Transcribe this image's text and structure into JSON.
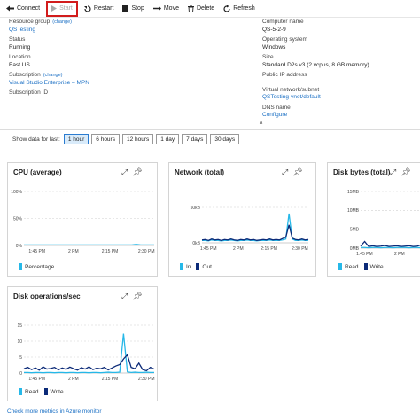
{
  "toolbar": {
    "connect": "Connect",
    "start": "Start",
    "restart": "Restart",
    "stop": "Stop",
    "move": "Move",
    "delete": "Delete",
    "refresh": "Refresh"
  },
  "essentials": {
    "resource_group_label": "Resource group",
    "change_label": "(change)",
    "resource_group_value": "QSTesting",
    "status_label": "Status",
    "status_value": "Running",
    "location_label": "Location",
    "location_value": "East US",
    "subscription_label": "Subscription",
    "subscription_value": "Visual Studio Enterprise – MPN",
    "subscription_id_label": "Subscription ID",
    "computer_name_label": "Computer name",
    "computer_name_value": "QS-5-2-9",
    "os_label": "Operating system",
    "os_value": "Windows",
    "size_label": "Size",
    "size_value": "Standard D2s v3 (2 vcpus, 8 GB memory)",
    "public_ip_label": "Public IP address",
    "vnet_label": "Virtual network/subnet",
    "vnet_value": "QSTesting-vnet/default",
    "dns_label": "DNS name",
    "dns_value": "Configure"
  },
  "time_range": {
    "label": "Show data for last:",
    "options": [
      "1 hour",
      "6 hours",
      "12 hours",
      "1 day",
      "7 days",
      "30 days"
    ],
    "selected": "1 hour"
  },
  "colors": {
    "accent_blue": "#1a6fc4",
    "series_light": "#26b8e8",
    "series_dark": "#0b2a78",
    "highlight_red": "#d21c1c"
  },
  "footer_link": "Check more metrics in Azure monitor",
  "chart_data": [
    {
      "type": "line",
      "title": "CPU (average)",
      "y_ticks": [
        "100%",
        "50%",
        "0%"
      ],
      "ylim": [
        0,
        100
      ],
      "x_ticks": [
        "1:45 PM",
        "2 PM",
        "2:15 PM",
        "2:30 PM"
      ],
      "series": [
        {
          "name": "Percentage",
          "color": "#26b8e8",
          "values": [
            1,
            1,
            1,
            1,
            1,
            1,
            1,
            1,
            1,
            1,
            1,
            1,
            1,
            1,
            1,
            1,
            1,
            1,
            1,
            1,
            1,
            1,
            1,
            1,
            1,
            2,
            1,
            1,
            1,
            1
          ]
        }
      ]
    },
    {
      "type": "line",
      "title": "Network (total)",
      "y_ticks": [
        "50kB",
        "0kB"
      ],
      "ylim": [
        0,
        75
      ],
      "x_ticks": [
        "1:45 PM",
        "2 PM",
        "2:15 PM",
        "2:30 PM"
      ],
      "series": [
        {
          "name": "In",
          "color": "#26b8e8",
          "values": [
            5,
            5,
            4,
            6,
            5,
            5,
            4,
            5,
            5,
            6,
            5,
            4,
            5,
            5,
            6,
            5,
            5,
            4,
            5,
            5,
            5,
            6,
            5,
            5,
            5,
            6,
            8,
            62,
            8,
            5,
            5,
            6,
            5,
            5
          ]
        },
        {
          "name": "Out",
          "color": "#0b2a78",
          "values": [
            6,
            7,
            5,
            8,
            6,
            7,
            5,
            7,
            6,
            8,
            6,
            5,
            7,
            6,
            8,
            6,
            7,
            5,
            6,
            7,
            6,
            8,
            6,
            7,
            6,
            9,
            12,
            38,
            10,
            7,
            6,
            8,
            6,
            7
          ]
        }
      ]
    },
    {
      "type": "line",
      "title": "Disk bytes (total)",
      "y_ticks": [
        "15MB",
        "10MB",
        "5MB",
        "0MB"
      ],
      "ylim": [
        0,
        17
      ],
      "x_ticks": [
        "1:45 PM",
        "2 PM"
      ],
      "series": [
        {
          "name": "Read",
          "color": "#26b8e8",
          "values": [
            0.2,
            0.2,
            0.1,
            0.2,
            0.2,
            0.1,
            0.2,
            0.2,
            0.1,
            0.2,
            0.2,
            0.2,
            0.1,
            0.2,
            0.2,
            0.1,
            0.2
          ]
        },
        {
          "name": "Write",
          "color": "#0b2a78",
          "values": [
            0.6,
            2.0,
            0.5,
            0.7,
            0.5,
            0.6,
            0.8,
            0.5,
            0.6,
            0.7,
            0.5,
            0.6,
            0.7,
            0.5,
            0.6,
            1.0,
            0.5
          ]
        }
      ]
    },
    {
      "type": "line",
      "title": "Disk operations/sec",
      "y_ticks": [
        "15",
        "10",
        "5",
        "0"
      ],
      "ylim": [
        0,
        17
      ],
      "x_ticks": [
        "1:45 PM",
        "2 PM",
        "2:15 PM",
        "2:30 PM"
      ],
      "series": [
        {
          "name": "Read",
          "color": "#26b8e8",
          "values": [
            0.2,
            0.2,
            0.1,
            0.2,
            0.2,
            0.1,
            0.2,
            0.2,
            0.1,
            0.2,
            0.2,
            0.1,
            0.2,
            0.2,
            0.1,
            0.2,
            0.2,
            0.1,
            0.2,
            0.2,
            0.1,
            0.2,
            0.3,
            0.2,
            0.2,
            0.3,
            14,
            0.4,
            0.2,
            0.3,
            0.2,
            0.2,
            0.3,
            0.2,
            0.2
          ]
        },
        {
          "name": "Write",
          "color": "#0b2a78",
          "values": [
            1.5,
            2.0,
            1.2,
            1.8,
            1.0,
            2.2,
            1.4,
            1.6,
            2.0,
            1.1,
            1.8,
            1.3,
            2.1,
            1.5,
            1.0,
            1.9,
            1.4,
            2.2,
            1.2,
            1.7,
            1.5,
            2.0,
            1.1,
            1.8,
            2.5,
            3.0,
            5.0,
            6.5,
            2.0,
            1.5,
            3.5,
            1.2,
            0.8,
            2.0,
            1.4
          ]
        }
      ]
    }
  ]
}
